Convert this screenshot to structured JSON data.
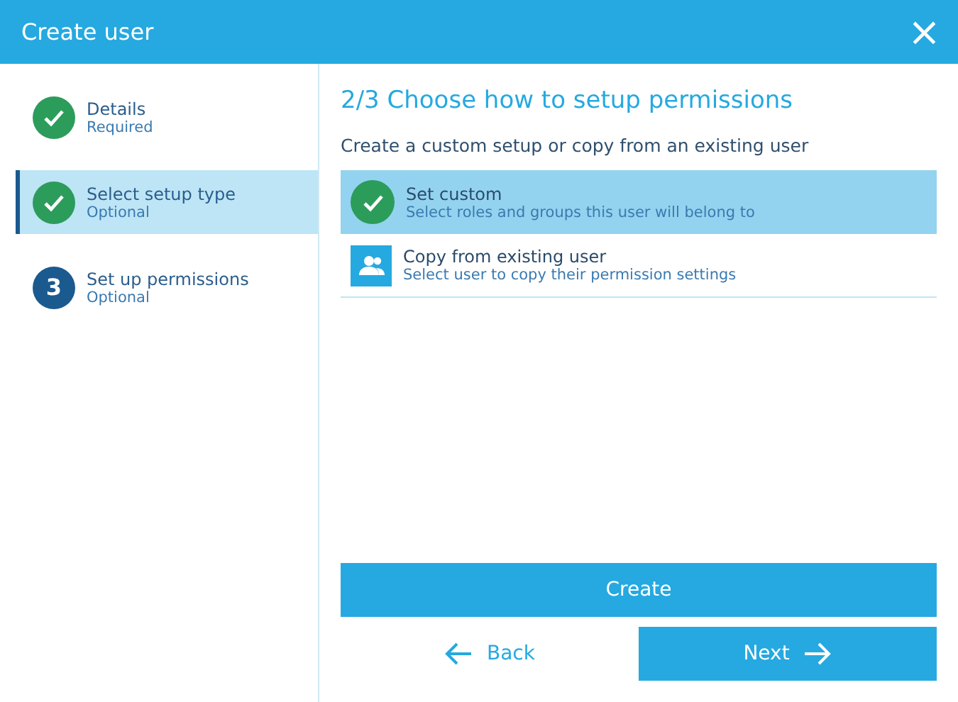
{
  "window": {
    "title": "Create user",
    "close_icon": "×"
  },
  "steps": [
    {
      "title": "Details",
      "subtitle": "Required",
      "kind": "done",
      "selected": false
    },
    {
      "title": "Select setup type",
      "subtitle": "Optional",
      "kind": "done",
      "selected": true
    },
    {
      "title": "Set up permissions",
      "subtitle": "Optional",
      "kind": "number",
      "number": "3",
      "selected": false
    }
  ],
  "heading": "2/3 Choose how to setup permissions",
  "instruction": "Create a custom setup or copy from an existing user",
  "options": [
    {
      "title": "Set custom",
      "description": "Select roles and groups this user will belong to",
      "kind": "check",
      "selected": true
    },
    {
      "title": "Copy from existing user",
      "description": "Select user to copy their permission settings",
      "kind": "users",
      "selected": false
    }
  ],
  "buttons": {
    "create": "Create",
    "back": "Back",
    "next": "Next"
  }
}
